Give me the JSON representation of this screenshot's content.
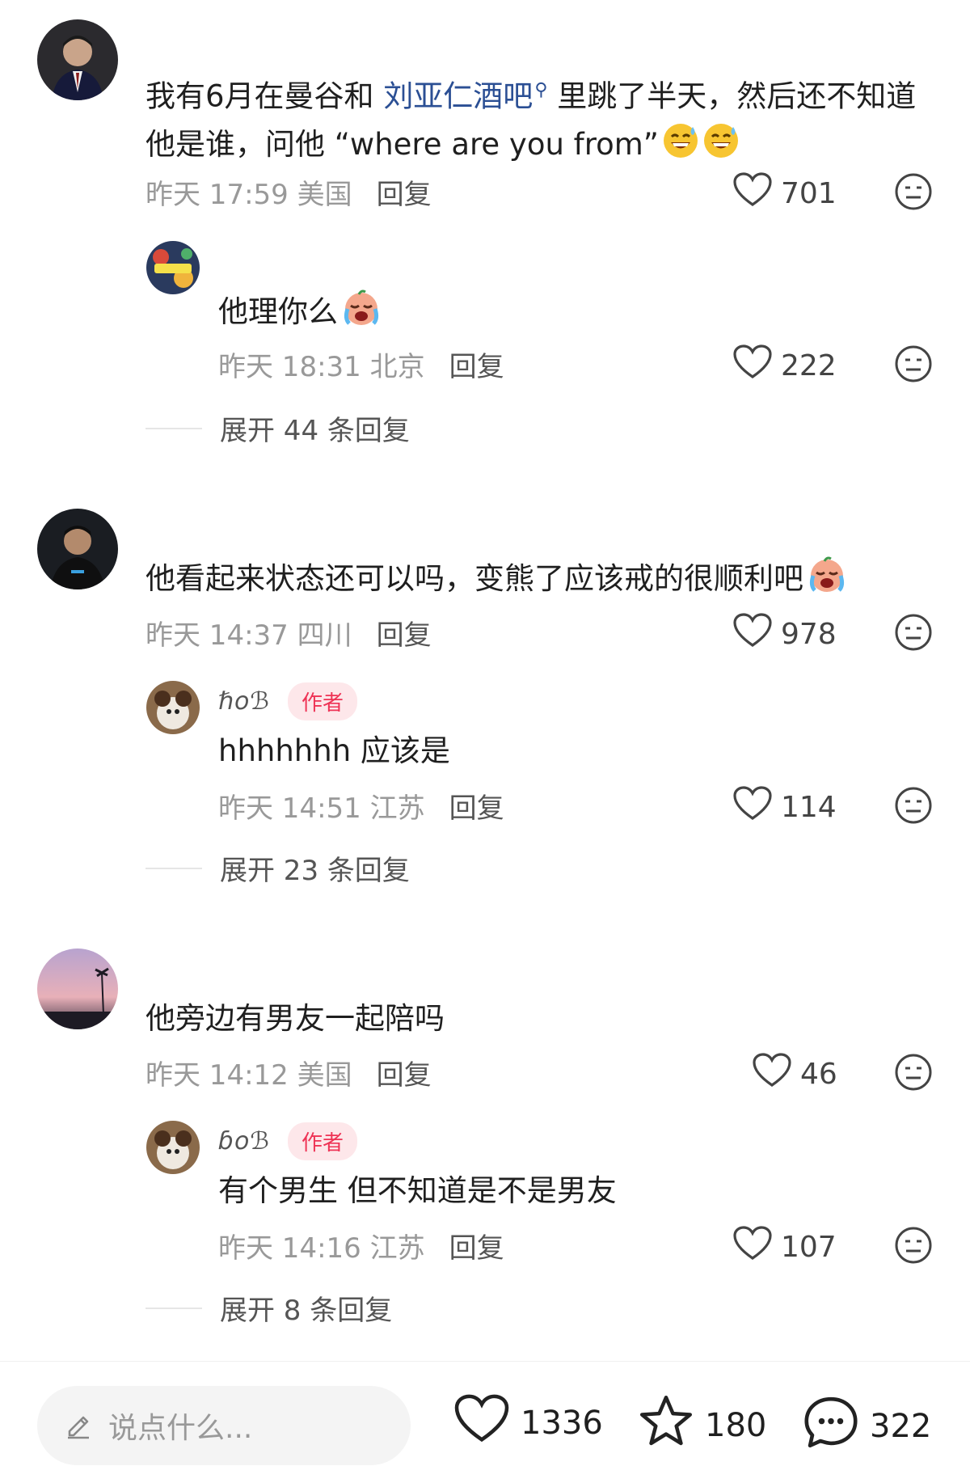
{
  "comments": [
    {
      "text_pre": "我有6月在曼谷和 ",
      "link": "刘亚仁酒吧",
      "text_post": " 里跳了半天，然后还不知道他是谁，问他 “where are you from”",
      "time": "昨天 17:59",
      "location": "美国",
      "reply_label": "回复",
      "likes": "701",
      "emojis": [
        "sweat-smile",
        "sweat-smile"
      ],
      "replies": [
        {
          "text": "他理你么",
          "emojis": [
            "crying"
          ],
          "time": "昨天 18:31",
          "location": "北京",
          "reply_label": "回复",
          "likes": "222"
        }
      ],
      "expand": "展开 44 条回复"
    },
    {
      "text": "他看起来状态还可以吗，变熊了应该戒的很顺利吧",
      "emojis": [
        "crying"
      ],
      "time": "昨天 14:37",
      "location": "四川",
      "reply_label": "回复",
      "likes": "978",
      "replies": [
        {
          "author": "ℏoℬ",
          "badge": "作者",
          "text": "hhhhhhh 应该是",
          "time": "昨天 14:51",
          "location": "江苏",
          "reply_label": "回复",
          "likes": "114"
        }
      ],
      "expand": "展开 23 条回复"
    },
    {
      "text": "他旁边有男友一起陪吗",
      "time": "昨天 14:12",
      "location": "美国",
      "reply_label": "回复",
      "likes": "46",
      "replies": [
        {
          "author": "ɓoℬ",
          "badge": "作者",
          "text": "有个男生 但不知道是不是男友",
          "time": "昨天 14:16",
          "location": "江苏",
          "reply_label": "回复",
          "likes": "107"
        }
      ],
      "expand": "展开 8 条回复"
    }
  ],
  "bottom_bar": {
    "placeholder": "说点什么...",
    "likes": "1336",
    "favorites": "180",
    "comments": "322"
  },
  "colors": {
    "link": "#2b4f94",
    "badge_bg": "#fde7ea",
    "badge_text": "#ee3355",
    "meta": "#999999"
  }
}
